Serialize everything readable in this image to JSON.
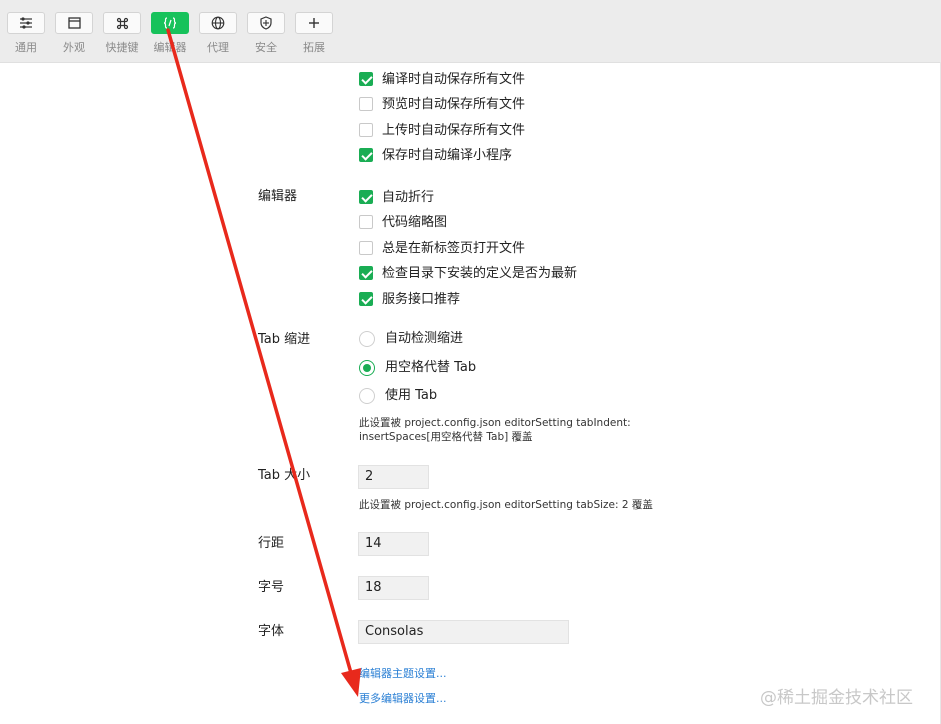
{
  "toolbar": {
    "items": [
      {
        "label": "通用",
        "icon": "sliders-icon"
      },
      {
        "label": "外观",
        "icon": "window-icon"
      },
      {
        "label": "快捷键",
        "icon": "command-key-icon"
      },
      {
        "label": "编辑器",
        "icon": "code-braces-icon",
        "active": true
      },
      {
        "label": "代理",
        "icon": "globe-icon"
      },
      {
        "label": "安全",
        "icon": "shield-icon"
      },
      {
        "label": "拓展",
        "icon": "plus-icon"
      }
    ]
  },
  "file_save": {
    "options": [
      {
        "label": "编译时自动保存所有文件",
        "checked": true
      },
      {
        "label": "预览时自动保存所有文件",
        "checked": false
      },
      {
        "label": "上传时自动保存所有文件",
        "checked": false
      },
      {
        "label": "保存时自动编译小程序",
        "checked": true
      }
    ]
  },
  "editor": {
    "label": "编辑器",
    "options": [
      {
        "label": "自动折行",
        "checked": true
      },
      {
        "label": "代码缩略图",
        "checked": false
      },
      {
        "label": "总是在新标签页打开文件",
        "checked": false
      },
      {
        "label": "检查目录下安装的定义是否为最新",
        "checked": true
      },
      {
        "label": "服务接口推荐",
        "checked": true
      }
    ]
  },
  "tab_indent": {
    "label": "Tab 缩进",
    "options": [
      {
        "label": "自动检测缩进",
        "checked": false
      },
      {
        "label": "用空格代替 Tab",
        "checked": true
      },
      {
        "label": "使用 Tab",
        "checked": false
      }
    ],
    "note_line1": "此设置被 project.config.json editorSetting tabIndent:",
    "note_line2": "insertSpaces[用空格代替 Tab] 覆盖"
  },
  "tab_size": {
    "label": "Tab 大小",
    "value": "2",
    "note": "此设置被 project.config.json editorSetting tabSize: 2 覆盖"
  },
  "line_height": {
    "label": "行距",
    "value": "14"
  },
  "font_size": {
    "label": "字号",
    "value": "18"
  },
  "font_family": {
    "label": "字体",
    "value": "Consolas"
  },
  "links": {
    "theme": "编辑器主题设置...",
    "more": "更多编辑器设置..."
  },
  "watermark": "@稀土掘金技术社区",
  "colors": {
    "accent": "#1aad54",
    "toolbar_active": "#17c25b",
    "link": "#2a7fd4",
    "annotation_arrow": "#e8291c"
  }
}
